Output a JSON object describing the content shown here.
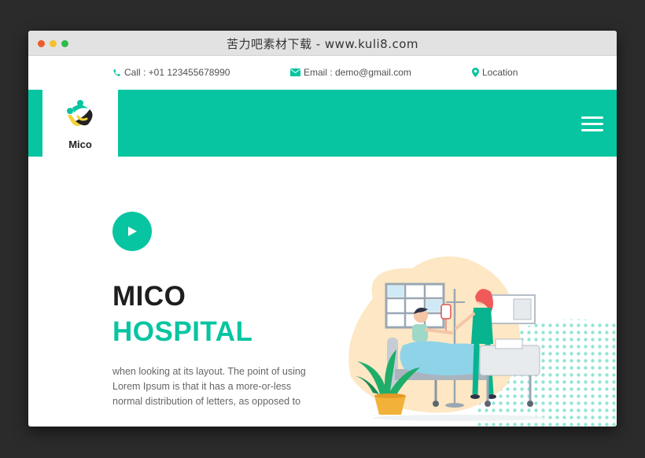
{
  "browser": {
    "title": "苦力吧素材下载 - www.kuli8.com"
  },
  "topbar": {
    "call_text": "Call : +01 123455678990",
    "email_text": "Email : demo@gmail.com",
    "location_text": "Location"
  },
  "navbar": {
    "logo_text": "Mico"
  },
  "hero": {
    "title_line1": "MICO",
    "title_line2": "HOSPITAL",
    "description": "when looking at its layout. The point of using Lorem Ipsum is that it has a more-or-less normal distribution of letters, as opposed to"
  },
  "colors": {
    "accent": "#07c5a0",
    "background": "#2b2b2b",
    "heading": "#1e1e1e",
    "body_text": "#666666"
  },
  "icons": [
    "phone-icon",
    "envelope-icon",
    "map-marker-icon",
    "hamburger-menu-icon",
    "play-icon"
  ]
}
